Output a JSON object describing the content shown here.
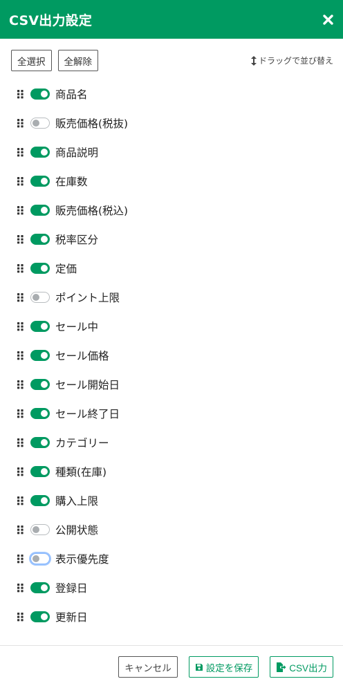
{
  "header": {
    "title": "CSV出力設定",
    "close_icon": "close-icon"
  },
  "toolbar": {
    "select_all": "全選択",
    "deselect_all": "全解除",
    "drag_hint": "ドラッグで並び替え"
  },
  "colors": {
    "brand": "#009a61",
    "toggle_off": "#a9adb0"
  },
  "fields": [
    {
      "label": "商品名",
      "enabled": true
    },
    {
      "label": "販売価格(税抜)",
      "enabled": false
    },
    {
      "label": "商品説明",
      "enabled": true
    },
    {
      "label": "在庫数",
      "enabled": true
    },
    {
      "label": "販売価格(税込)",
      "enabled": true
    },
    {
      "label": "税率区分",
      "enabled": true
    },
    {
      "label": "定価",
      "enabled": true
    },
    {
      "label": "ポイント上限",
      "enabled": false
    },
    {
      "label": "セール中",
      "enabled": true
    },
    {
      "label": "セール価格",
      "enabled": true
    },
    {
      "label": "セール開始日",
      "enabled": true
    },
    {
      "label": "セール終了日",
      "enabled": true
    },
    {
      "label": "カテゴリー",
      "enabled": true
    },
    {
      "label": "種類(在庫)",
      "enabled": true
    },
    {
      "label": "購入上限",
      "enabled": true
    },
    {
      "label": "公開状態",
      "enabled": false
    },
    {
      "label": "表示優先度",
      "enabled": false,
      "focused": true
    },
    {
      "label": "登録日",
      "enabled": true
    },
    {
      "label": "更新日",
      "enabled": true
    }
  ],
  "footer": {
    "cancel": "キャンセル",
    "save": "設定を保存",
    "export": "CSV出力"
  }
}
